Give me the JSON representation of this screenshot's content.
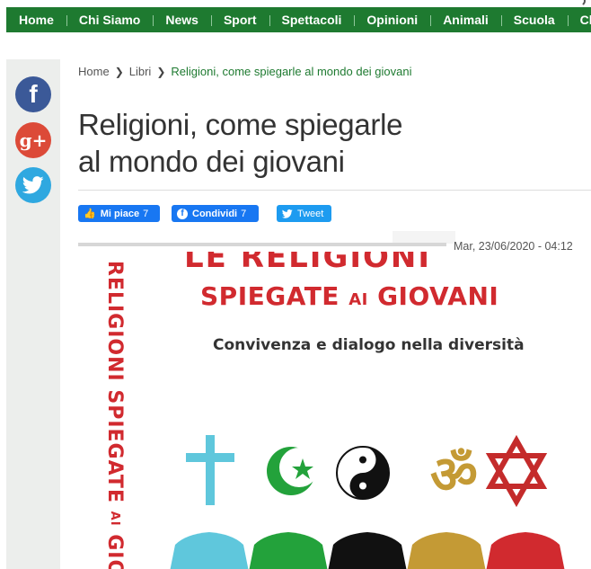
{
  "nav": {
    "items": [
      "Home",
      "Chi Siamo",
      "News",
      "Sport",
      "Spettacoli",
      "Opinioni",
      "Animali",
      "Scuola",
      "Club L"
    ]
  },
  "social": {
    "facebook_glyph": "f",
    "googleplus_glyph": "g+",
    "twitter_icon": "twitter-bird-icon"
  },
  "breadcrumb": {
    "home": "Home",
    "section": "Libri",
    "current": "Religioni, come spiegarle al mondo dei giovani"
  },
  "article": {
    "title_line1": "Religioni, come spiegarle",
    "title_line2": "al mondo dei giovani",
    "date": "Mar, 23/06/2020 - 04:12"
  },
  "share": {
    "like_label": "Mi piace",
    "like_count": "7",
    "share_label": "Condividi",
    "share_count": "7",
    "tweet_label": "Tweet"
  },
  "cover": {
    "spine_main": "RELIGIONI SPIEGATE",
    "spine_ai": "AI",
    "spine_end": "GIO",
    "head1": "LE RELIGIONI",
    "head2_a": "SPIEGATE ",
    "head2_ai": "AI",
    "head2_b": " GIOVANI",
    "subtitle": "Convivenza e dialogo nella diversità"
  },
  "colors": {
    "nav_green": "#1e7a30",
    "brand_red": "#d12a2f",
    "facebook": "#3b5998",
    "googleplus": "#dc4a38",
    "twitter": "#2fa8e0"
  }
}
